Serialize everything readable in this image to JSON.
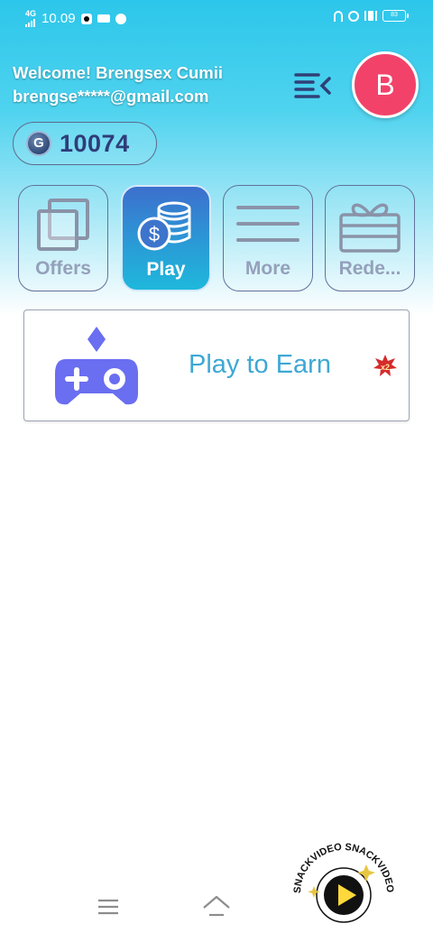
{
  "status_bar": {
    "network": "4G",
    "time": "10.09",
    "battery": "83"
  },
  "header": {
    "welcome": "Welcome! Brengsex Cumii",
    "email": "brengse*****@gmail.com",
    "avatar_letter": "B"
  },
  "balance": {
    "coin_letter": "G",
    "value": "10074"
  },
  "tabs": [
    {
      "label": "Offers",
      "icon": "stacked-squares-icon",
      "active": false
    },
    {
      "label": "Play",
      "icon": "coin-stack-dollar-icon",
      "active": true
    },
    {
      "label": "More",
      "icon": "lines-icon",
      "active": false
    },
    {
      "label": "Rede...",
      "icon": "gift-icon",
      "active": false
    }
  ],
  "card": {
    "title": "Play to Earn",
    "badge": "x2",
    "icon": "gamepad-icon"
  },
  "bottom_nav": {
    "items": [
      "menu-icon",
      "home-icon"
    ]
  },
  "watermark": {
    "text": "SNACKVIDEO SNACKVIDEO SNACKVIDEO"
  },
  "colors": {
    "accent": "#2cc6ea",
    "avatar": "#f2426a",
    "card_title": "#3ea8d4",
    "active_tab_start": "#3d6fcd",
    "active_tab_end": "#1fb8dc",
    "gamepad": "#6a6ef0"
  }
}
